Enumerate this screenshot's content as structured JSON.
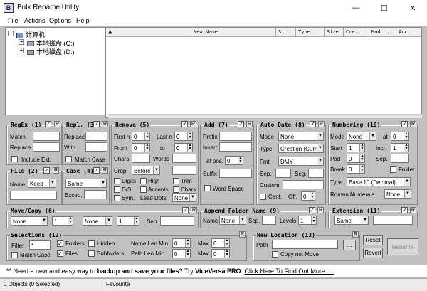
{
  "window": {
    "title": "Bulk Rename Utility",
    "min": "—",
    "max": "☐",
    "close": "✕"
  },
  "menu": [
    "File",
    "Actions",
    "Options",
    "Help"
  ],
  "tree": {
    "root": "计算机",
    "drives": [
      "本地磁盘 (C:)",
      "本地磁盘 (D:)"
    ]
  },
  "filelist": {
    "columns": [
      "New Name",
      "S...",
      "Type",
      "Size",
      "Cre...",
      "Mod...",
      "Acc..."
    ]
  },
  "regex": {
    "title": "RegEx (1)",
    "match_label": "Match",
    "replace_label": "Replace",
    "include_ext": "Include Ext."
  },
  "repl": {
    "title": "Repl. (3)",
    "replace_label": "Replace",
    "with_label": "With",
    "match_case": "Match Case"
  },
  "remove": {
    "title": "Remove (5)",
    "first_n": "First n",
    "first_n_val": "0",
    "last_n": "Last n",
    "last_n_val": "0",
    "from": "From",
    "from_val": "0",
    "to": "to",
    "to_val": "0",
    "chars": "Chars",
    "words": "Words",
    "crop": "Crop",
    "crop_val": "Before",
    "digits": "Digits",
    "high": "High",
    "trim": "Trim",
    "ds": "D/S",
    "accents": "Accents",
    "chars2": "Chars",
    "sym": "Sym.",
    "lead_dots": "Lead Dots",
    "lead_dots_val": "None"
  },
  "add": {
    "title": "Add (7)",
    "prefix": "Prefix",
    "insert": "Insert",
    "at_pos": "at pos.",
    "at_pos_val": "0",
    "suffix": "Suffix",
    "word_space": "Word Space"
  },
  "autodate": {
    "title": "Auto Date (8)",
    "mode": "Mode",
    "mode_val": "None",
    "type": "Type",
    "type_val": "Creation (Curr.)",
    "fmt": "Fmt",
    "fmt_val": "DMY",
    "sep": "Sep.",
    "seg": "Seg.",
    "custom": "Custom",
    "cent": "Cent.",
    "off": "Off.",
    "off_val": "0"
  },
  "numbering": {
    "title": "Numbering (10)",
    "mode": "Mode",
    "mode_val": "None",
    "at": "at",
    "at_val": "0",
    "start": "Start",
    "start_val": "1",
    "incr": "Incr.",
    "incr_val": "1",
    "pad": "Pad",
    "pad_val": "0",
    "sep": "Sep.",
    "break": "Break",
    "break_val": "0",
    "folder": "Folder",
    "type": "Type",
    "type_val": "Base 10 (Decimal)",
    "roman": "Roman Numerals",
    "roman_val": "None"
  },
  "file": {
    "title": "File (2)",
    "name": "Name",
    "name_val": "Keep"
  },
  "case": {
    "title": "Case (4)",
    "case_val": "Same",
    "excep": "Excep."
  },
  "movecopy": {
    "title": "Move/Copy (6)",
    "sel1": "None",
    "num1": "1",
    "sel2": "None",
    "num2": "1",
    "sep": "Sep."
  },
  "append": {
    "title": "Append Folder Name (9)",
    "name": "Name",
    "name_val": "None",
    "sep": "Sep.",
    "levels": "Levels",
    "levels_val": "1"
  },
  "extension": {
    "title": "Extension (11)",
    "val": "Same"
  },
  "selections": {
    "title": "Selections (12)",
    "filter": "Filter",
    "filter_val": "*",
    "folders": "Folders",
    "hidden": "Hidden",
    "name_len_min": "Name Len Min",
    "name_len_min_val": "0",
    "max": "Max",
    "max_val": "0",
    "match_case": "Match Case",
    "files": "Files",
    "subfolders": "Subfolders",
    "path_len_min": "Path Len Min",
    "path_len_min_val": "0",
    "max2": "Max",
    "max2_val": "0"
  },
  "newloc": {
    "title": "New Location (13)",
    "path": "Path",
    "copy_not_move": "Copy not Move",
    "browse": "..."
  },
  "buttons": {
    "reset": "Reset",
    "revert": "Revert",
    "rename": "Rename"
  },
  "promo": {
    "prefix": "** Need a new and easy way to ",
    "bold": "backup and save your files",
    "mid": "? Try ",
    "brand": "ViceVersa PRO",
    "dot": ". ",
    "link": "Click Here To Find Out More ...."
  },
  "status": {
    "objects": "0 Objects (0 Selected)",
    "favourite": "Favourite"
  }
}
